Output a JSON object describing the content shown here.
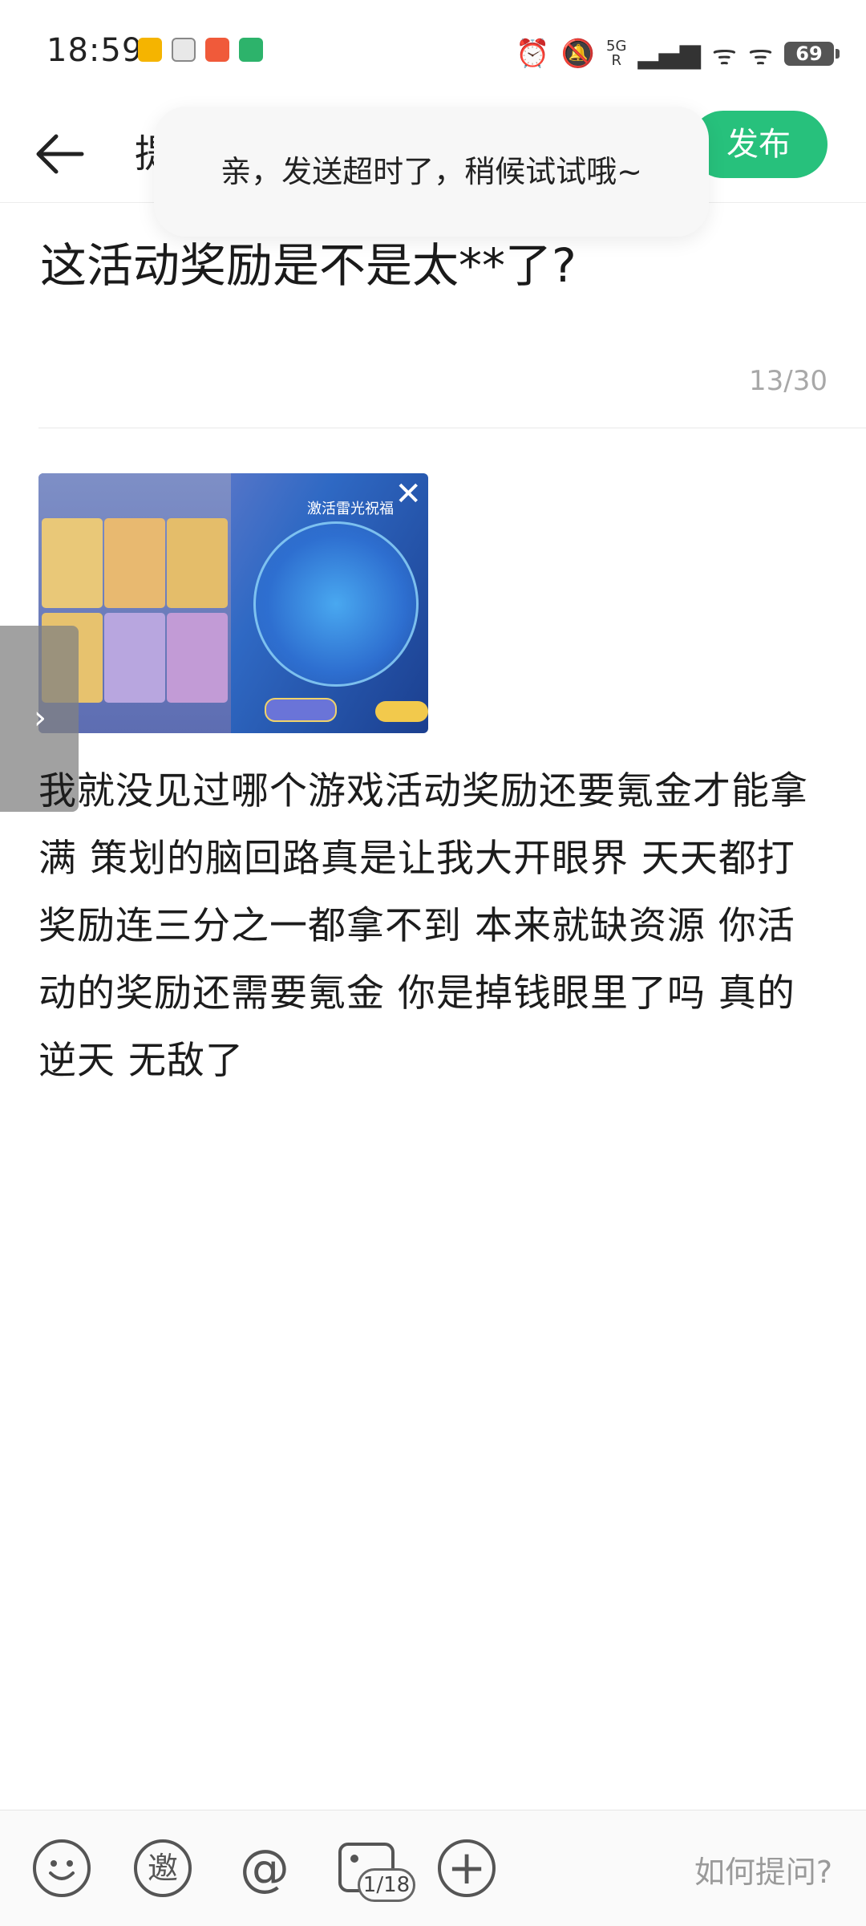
{
  "status_bar": {
    "time": "18:59",
    "network": "5G",
    "network_sub": "R",
    "battery": "69"
  },
  "header": {
    "back_icon": "arrow-left-icon",
    "title_partial": "提",
    "publish_label": "发布"
  },
  "toast": {
    "message": "亲，发送超时了，稍候试试哦~"
  },
  "post": {
    "title": "这活动奖励是不是太**了?",
    "title_count": "13/30",
    "body": "我就没见过哪个游戏活动奖励还要氪金才能拿满 策划的脑回路真是让我大开眼界 天天都打奖励连三分之一都拿不到 本来就缺资源 你活动的奖励还需要氪金 你是掉钱眼里了吗 真的逆天 无敌了"
  },
  "attached_image": {
    "banner_text": "激活雷光祝福",
    "close_icon": "close-icon"
  },
  "toolbar": {
    "emoji_icon": "emoji-icon",
    "invite_icon": "invite-icon",
    "invite_glyph": "邀",
    "mention_icon": "at-icon",
    "mention_glyph": "@",
    "image_icon": "image-icon",
    "image_count": "1/18",
    "add_icon": "plus-icon",
    "add_glyph": "+",
    "how_to_ask": "如何提问?"
  },
  "colors": {
    "accent": "#27c17c",
    "text": "#1c1c1c",
    "muted": "#a8a8a8"
  }
}
